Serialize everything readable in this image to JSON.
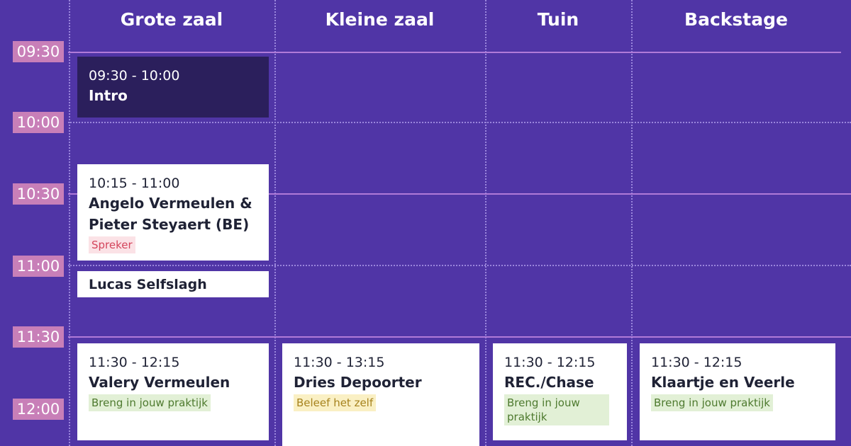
{
  "rooms": [
    "Grote zaal",
    "Kleine zaal",
    "Tuin",
    "Backstage"
  ],
  "times": [
    "09:30",
    "10:00",
    "10:30",
    "11:00",
    "11:30",
    "12:00"
  ],
  "sessions": {
    "intro": {
      "time": "09:30 - 10:00",
      "title": "Intro"
    },
    "angelo": {
      "time": "10:15 - 11:00",
      "title": "Angelo Vermeulen & Pieter Steyaert (BE)",
      "tag": "Spreker"
    },
    "lucas": {
      "title": "Lucas Selfslagh"
    },
    "valery": {
      "time": "11:30 - 12:15",
      "title": "Valery Vermeulen",
      "tag": "Breng in jouw praktijk"
    },
    "dries": {
      "time": "11:30 - 13:15",
      "title": "Dries Depoorter",
      "tag": "Beleef het zelf"
    },
    "rec": {
      "time": "11:30 - 12:15",
      "title": "REC./Chase",
      "tag": "Breng in jouw praktijk"
    },
    "klaartje": {
      "time": "11:30 - 12:15",
      "title": "Klaartje en Veerle",
      "tag": "Breng in jouw praktijk"
    }
  },
  "colors": {
    "background": "#5035a6",
    "time_badge": "#c87fb8",
    "dark_card": "#2b1f5c",
    "tag_spreker": "#fbe2e6",
    "tag_praktijk": "#e2f0d6",
    "tag_beleef": "#faf0c4"
  }
}
